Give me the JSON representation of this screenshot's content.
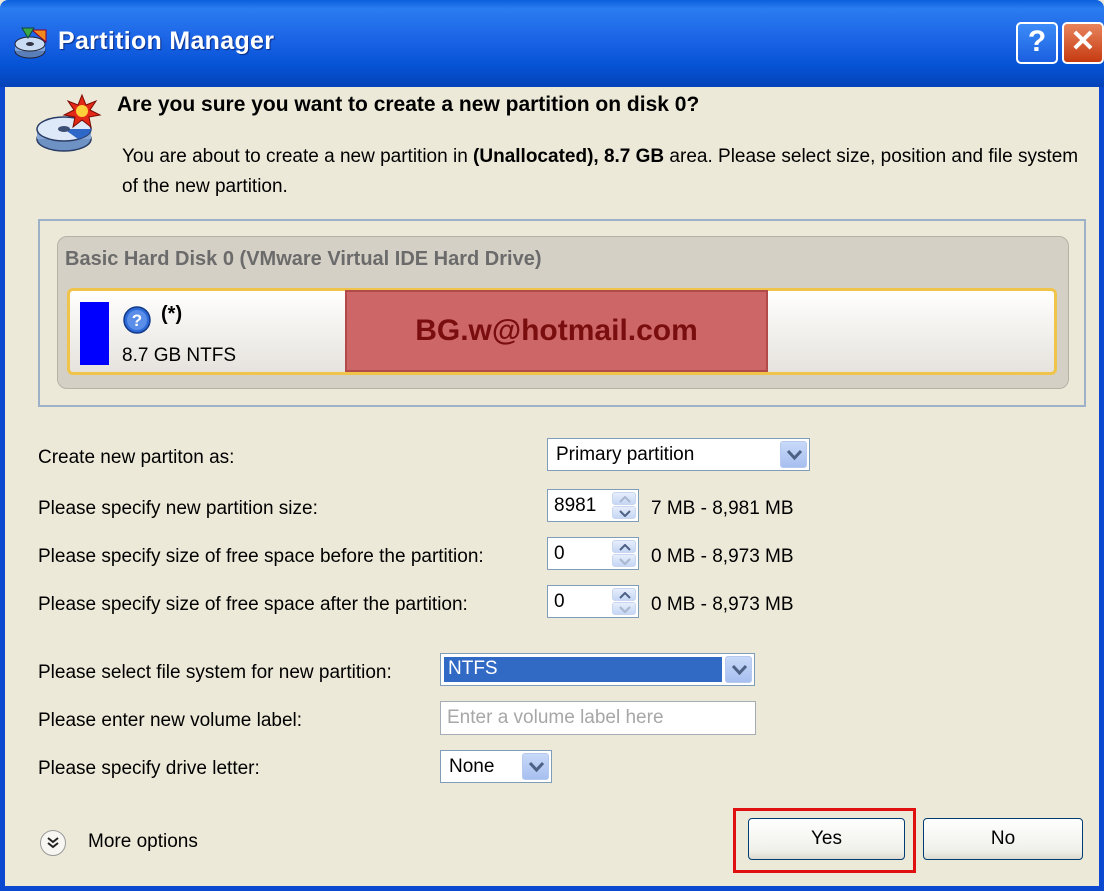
{
  "window": {
    "title": "Partition Manager",
    "help_glyph": "?",
    "close_glyph": "✕"
  },
  "header": {
    "question": "Are you sure you want to create a new partition on disk 0?",
    "desc_prefix": "You are about to create a new partition in ",
    "desc_bold": "(Unallocated), 8.7 GB",
    "desc_suffix": " area. Please select size, position and file system of the new partition."
  },
  "disk": {
    "title": "Basic Hard Disk 0 (VMware Virtual IDE Hard Drive)",
    "partition_name": "(*)",
    "partition_info": "8.7 GB NTFS",
    "partition_color": "#0000ff",
    "watermark_text": "BG.w@hotmail.com"
  },
  "form": {
    "type_label": "Create new partiton as:",
    "type_value": "Primary partition",
    "size_label": "Please specify new partition size:",
    "size_value": "8981",
    "size_range": "7 MB - 8,981 MB",
    "before_label": "Please specify size of free space before the partition:",
    "before_value": "0",
    "before_range": "0 MB - 8,973 MB",
    "after_label": "Please specify size of free space after the partition:",
    "after_value": "0",
    "after_range": "0 MB - 8,973 MB",
    "fs_label": "Please select file system for new partition:",
    "fs_value": "NTFS",
    "volume_label": "Please enter new volume label:",
    "volume_placeholder": "Enter a volume label here",
    "volume_value": "",
    "letter_label": "Please specify drive letter:",
    "letter_value": "None"
  },
  "footer": {
    "more_options": "More options",
    "yes_label": "Yes",
    "no_label": "No"
  },
  "icons": {
    "app": "partition-manager-icon",
    "header": "new-partition-disk-icon",
    "partition": "unknown-filesystem-icon",
    "more": "expand-double-chevron-icon"
  },
  "colors": {
    "titlebar": "#0a5fdc",
    "dialog_bg": "#ece9d8",
    "selection": "#316ac5",
    "highlight": "#e01010"
  }
}
